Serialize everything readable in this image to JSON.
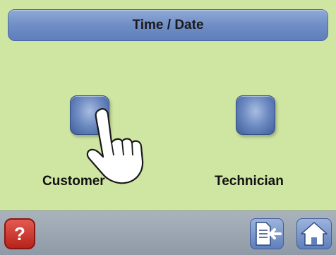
{
  "header": {
    "title": "Time / Date"
  },
  "options": [
    {
      "label": "Customer"
    },
    {
      "label": "Technician"
    }
  ],
  "footer": {
    "help_symbol": "?"
  },
  "icons": {
    "pointer": "hand-pointer-icon",
    "help": "question-icon",
    "exit": "exit-arrow-icon",
    "home": "home-icon"
  },
  "colors": {
    "background": "#cfe6a3",
    "accent_blue": "#6e8cc4",
    "help_red": "#c52b22"
  }
}
